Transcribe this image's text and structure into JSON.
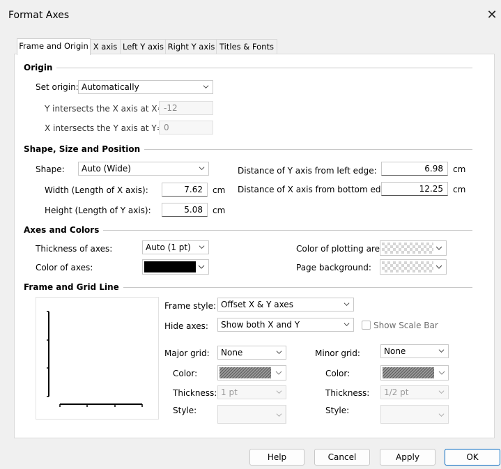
{
  "window": {
    "title": "Format Axes",
    "close_glyph": "✕"
  },
  "tabs": [
    {
      "label": "Frame and Origin",
      "active": true
    },
    {
      "label": "X axis"
    },
    {
      "label": "Left Y axis"
    },
    {
      "label": "Right Y axis"
    },
    {
      "label": "Titles & Fonts"
    }
  ],
  "origin": {
    "heading": "Origin",
    "set_origin_label": "Set origin:",
    "set_origin_value": "Automatically",
    "y_intersect_label": "Y intersects the X axis at X=",
    "y_intersect_value": "-12",
    "x_intersect_label": "X intersects the Y axis at Y=",
    "x_intersect_value": "0"
  },
  "shape": {
    "heading": "Shape, Size and Position",
    "shape_label": "Shape:",
    "shape_value": "Auto (Wide)",
    "width_label": "Width (Length of X axis):",
    "width_value": "7.62",
    "width_unit": "cm",
    "height_label": "Height (Length of Y axis):",
    "height_value": "5.08",
    "height_unit": "cm",
    "dist_y_label": "Distance of Y axis from left edge:",
    "dist_y_value": "6.98",
    "dist_y_unit": "cm",
    "dist_x_label": "Distance of X axis from bottom edge:",
    "dist_x_value": "12.25",
    "dist_x_unit": "cm"
  },
  "axes_colors": {
    "heading": "Axes and Colors",
    "thickness_label": "Thickness of axes:",
    "thickness_value": "Auto (1 pt)",
    "color_axes_label": "Color of axes:",
    "color_axes_hex": "#000000",
    "plot_area_label": "Color of plotting area:",
    "page_bg_label": "Page background:"
  },
  "frame_grid": {
    "heading": "Frame and Grid Line",
    "frame_style_label": "Frame style:",
    "frame_style_value": "Offset X & Y axes",
    "hide_axes_label": "Hide axes:",
    "hide_axes_value": "Show both X and Y",
    "show_scale_bar_label": "Show Scale Bar",
    "major_grid_label": "Major grid:",
    "major_grid_value": "None",
    "major_color_label": "Color:",
    "major_thickness_label": "Thickness:",
    "major_thickness_value": "1 pt",
    "major_style_label": "Style:",
    "minor_grid_label": "Minor grid:",
    "minor_grid_value": "None",
    "minor_color_label": "Color:",
    "minor_thickness_label": "Thickness:",
    "minor_thickness_value": "1/2 pt",
    "minor_style_label": "Style:"
  },
  "buttons": {
    "help": "Help",
    "cancel": "Cancel",
    "apply": "Apply",
    "ok": "OK"
  },
  "colors": {
    "accent": "#0067c0",
    "panel_bg": "#ffffff",
    "dialog_bg": "#f0f0f0"
  }
}
